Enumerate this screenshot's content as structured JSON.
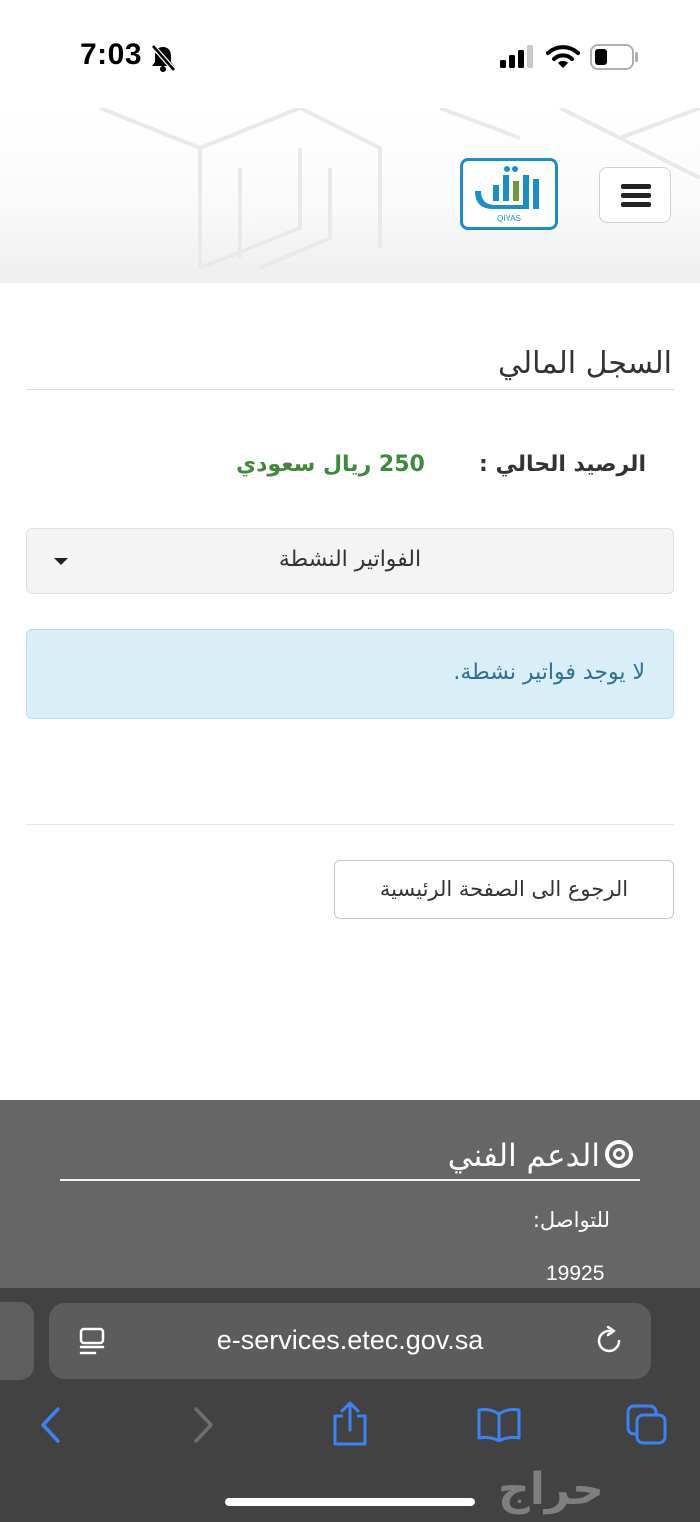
{
  "status_bar": {
    "time": "7:03"
  },
  "header": {
    "logo_text": "QIYAS"
  },
  "page": {
    "title": "السجل المالي",
    "balance_label": "الرصيد الحالي :",
    "balance_value": "250 ريال سعودي",
    "invoice_filter": "الفواتير النشطة",
    "empty_message": "لا يوجد فواتير نشطة.",
    "home_button": "الرجوع الى الصفحة الرئيسية"
  },
  "footer": {
    "support_title": "الدعم الفني",
    "contact_label": "للتواصل:",
    "contact_number": "19925"
  },
  "browser": {
    "url": "e-services.etec.gov.sa"
  },
  "colors": {
    "balance_green": "#3d8a3d",
    "logo_blue": "#1a8fc4",
    "alert_bg": "#d9eef6",
    "safari_blue": "#3b82f6"
  },
  "watermark": "حراج"
}
